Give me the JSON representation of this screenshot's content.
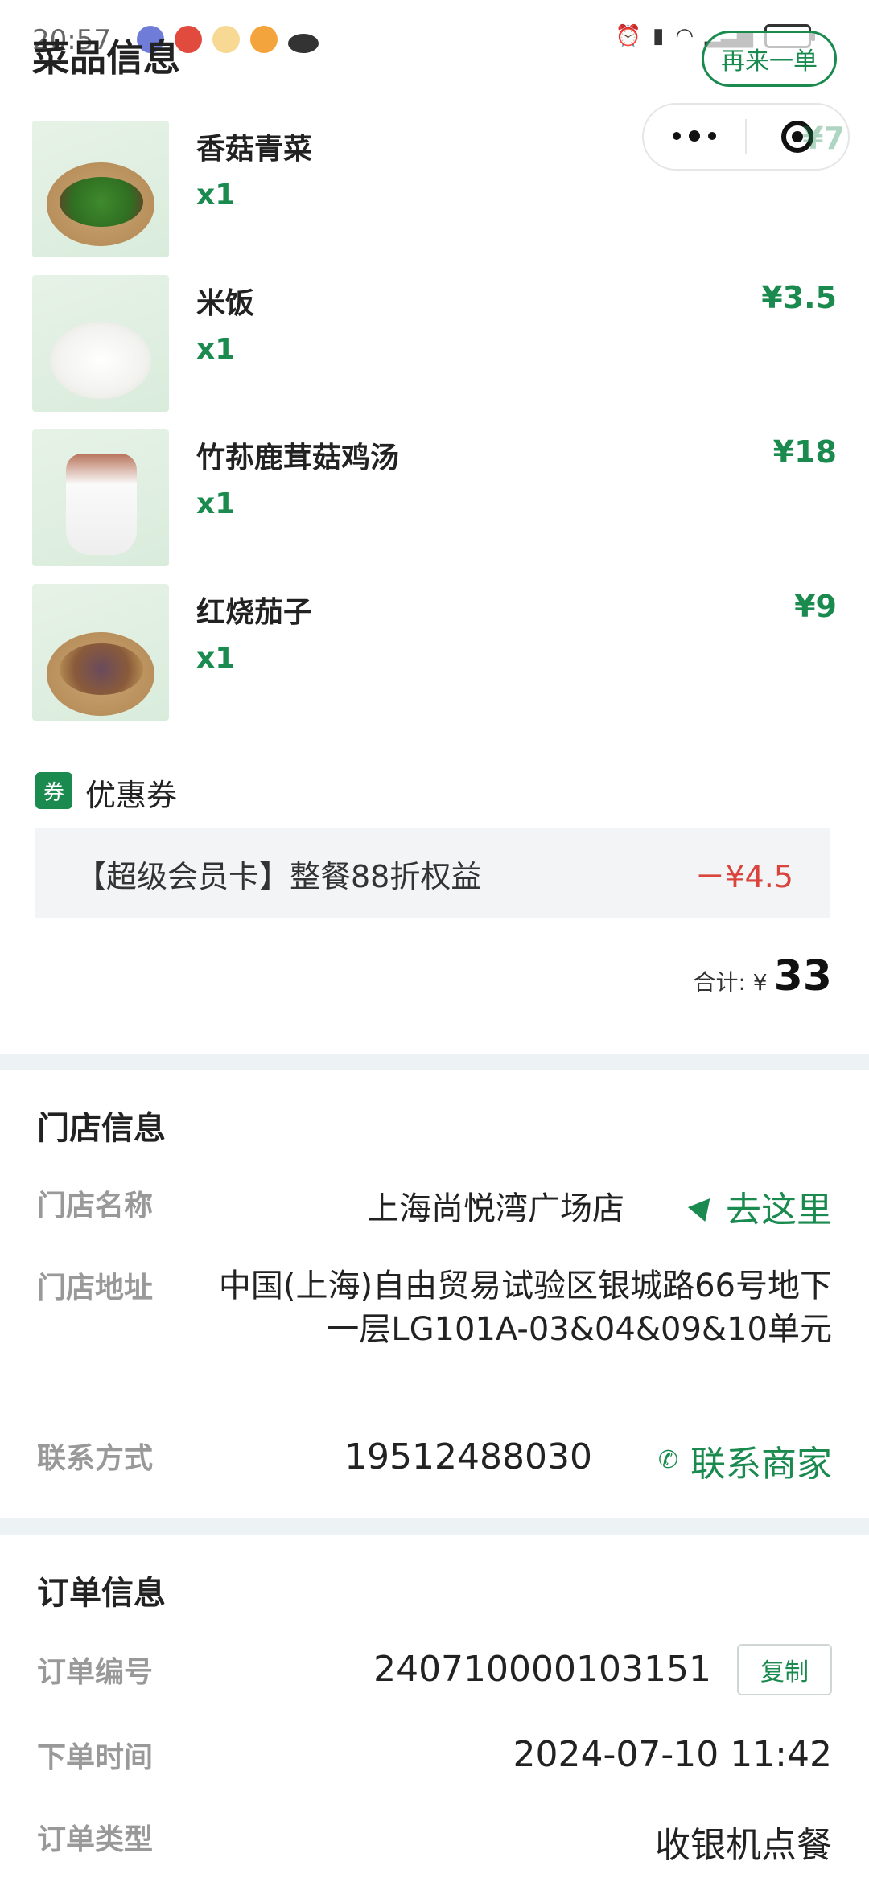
{
  "status_bar": {
    "time": "20:57"
  },
  "header": {
    "title": "菜品信息",
    "reorder_label": "再来一单"
  },
  "dishes": [
    {
      "name": "香菇青菜",
      "qty": "x1",
      "price": "¥7"
    },
    {
      "name": "米饭",
      "qty": "x1",
      "price": "¥3.5"
    },
    {
      "name": "竹荪鹿茸菇鸡汤",
      "qty": "x1",
      "price": "¥18"
    },
    {
      "name": "红烧茄子",
      "qty": "x1",
      "price": "¥9"
    }
  ],
  "coupon": {
    "tag": "券",
    "title": "优惠券",
    "name": "【超级会员卡】整餐88折权益",
    "amount": "－¥4.5"
  },
  "total": {
    "label": "合计: ¥",
    "amount": "33"
  },
  "store": {
    "title": "门店信息",
    "name_label": "门店名称",
    "name": "上海尚悦湾广场店",
    "navigate_label": "去这里",
    "address_label": "门店地址",
    "address": "中国(上海)自由贸易试验区银城路66号地下一层LG101A-03&04&09&10单元",
    "contact_label": "联系方式",
    "phone": "19512488030",
    "contact_action": "联系商家"
  },
  "order": {
    "title": "订单信息",
    "number_label": "订单编号",
    "number": "240710000103151",
    "copy_label": "复制",
    "time_label": "下单时间",
    "time": "2024-07-10 11:42",
    "type_label": "订单类型",
    "type": "收银机点餐"
  },
  "colors": {
    "accent": "#1a8a4f",
    "discount": "#d9453d",
    "divider": "#edf2f4"
  }
}
